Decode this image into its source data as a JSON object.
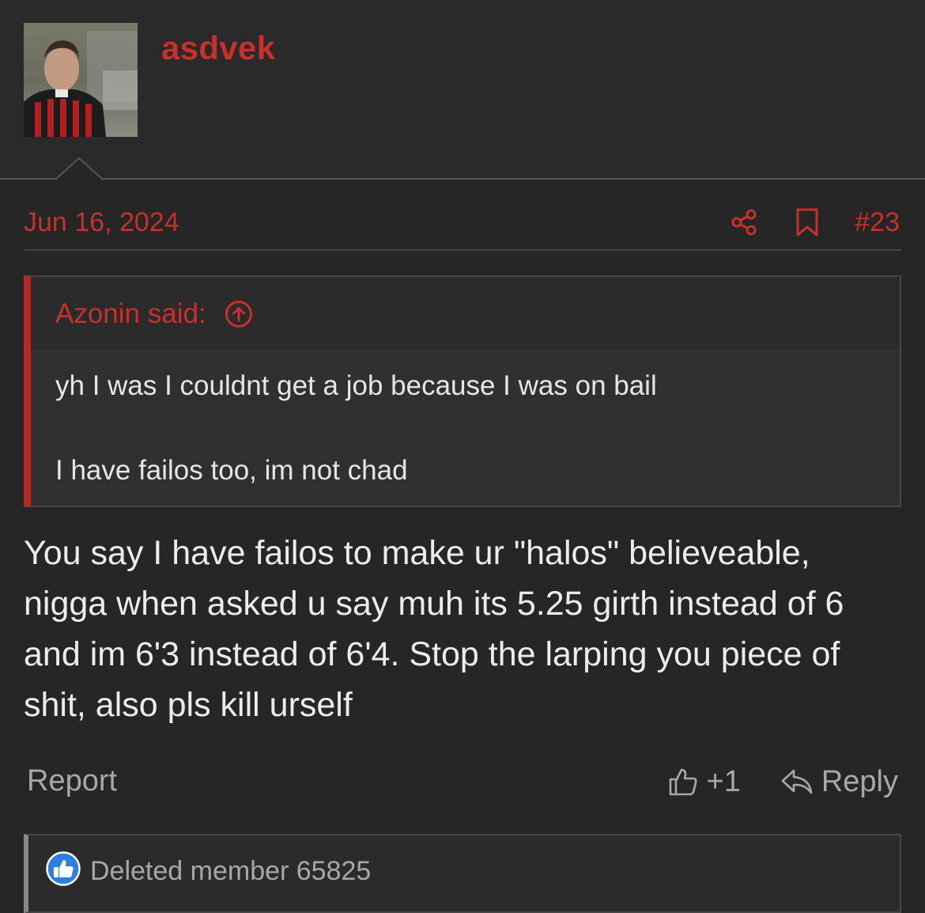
{
  "user": {
    "name": "asdvek",
    "avatar_icon": "avatar-photo",
    "name_color": "#c8302c"
  },
  "post": {
    "date": "Jun 16, 2024",
    "number": "#23",
    "share_icon": "share-icon",
    "bookmark_icon": "bookmark-icon"
  },
  "quote": {
    "author": "Azonin said:",
    "jump_icon": "arrow-up-circle-icon",
    "lines": [
      "yh I was I couldnt get a job because I was on bail",
      "I have failos too, im not chad"
    ]
  },
  "message": {
    "text": "You say I have failos to make ur \"halos\" believeable, nigga when asked u say muh its 5.25 girth instead of 6 and im 6'3 instead of 6'4. Stop the larping you piece of shit, also pls kill urself"
  },
  "actions": {
    "report": "Report",
    "like": "+1",
    "reply": "Reply"
  },
  "reactions": {
    "text": "Deleted member 65825",
    "badge_icon": "thumbs-up-badge-icon",
    "badge_color": "#2d7fe0"
  },
  "colors": {
    "background": "#262626",
    "accent": "#c8302c",
    "muted": "#a8a8a8"
  }
}
